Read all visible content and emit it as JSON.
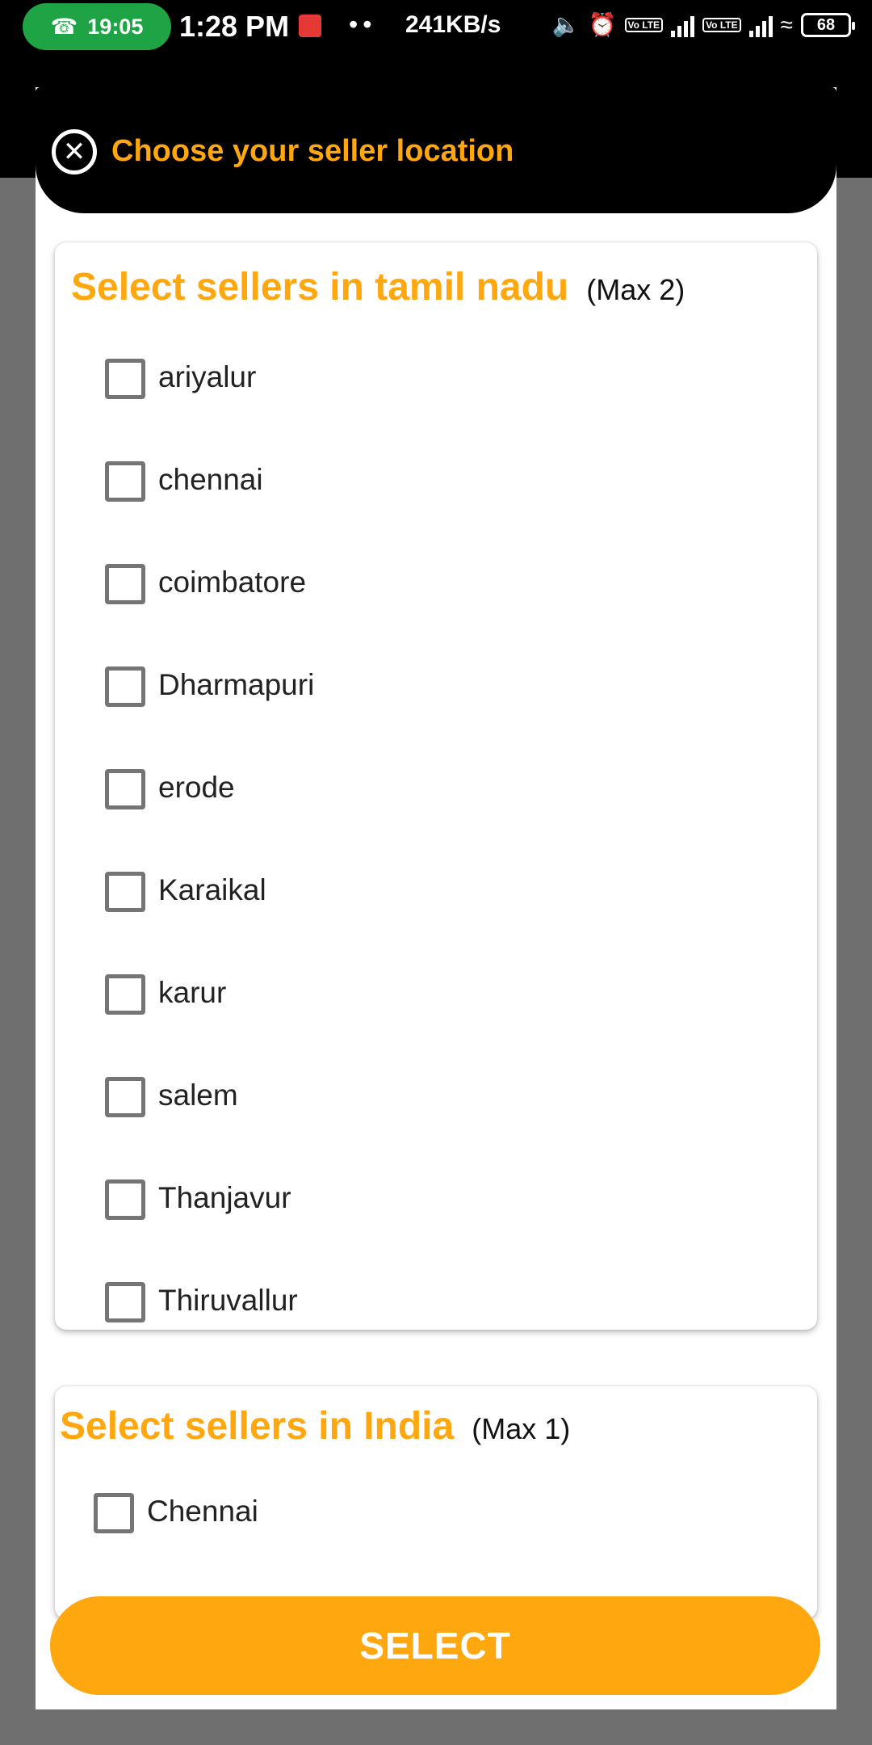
{
  "status_bar": {
    "call_time": "19:05",
    "time": "1:28 PM",
    "dots": "••",
    "net_speed": "241KB/s",
    "volte1": "Vo LTE",
    "volte2": "Vo LTE",
    "battery": "68"
  },
  "dialog": {
    "title": "Choose your seller location",
    "close_icon": "close-circle-icon",
    "sections": [
      {
        "title": "Select sellers in tamil nadu",
        "max": "(Max 2)",
        "items": [
          "ariyalur",
          "chennai",
          "coimbatore",
          "Dharmapuri",
          "erode",
          "Karaikal",
          "karur",
          "salem",
          "Thanjavur",
          "Thiruvallur"
        ]
      },
      {
        "title": "Select sellers in India",
        "max": "(Max 1)",
        "items": [
          "Chennai"
        ]
      }
    ],
    "select_label": "SELECT"
  },
  "colors": {
    "accent": "#ffa70f",
    "header_bg": "#000000",
    "overlay": "#6f6f6f"
  }
}
